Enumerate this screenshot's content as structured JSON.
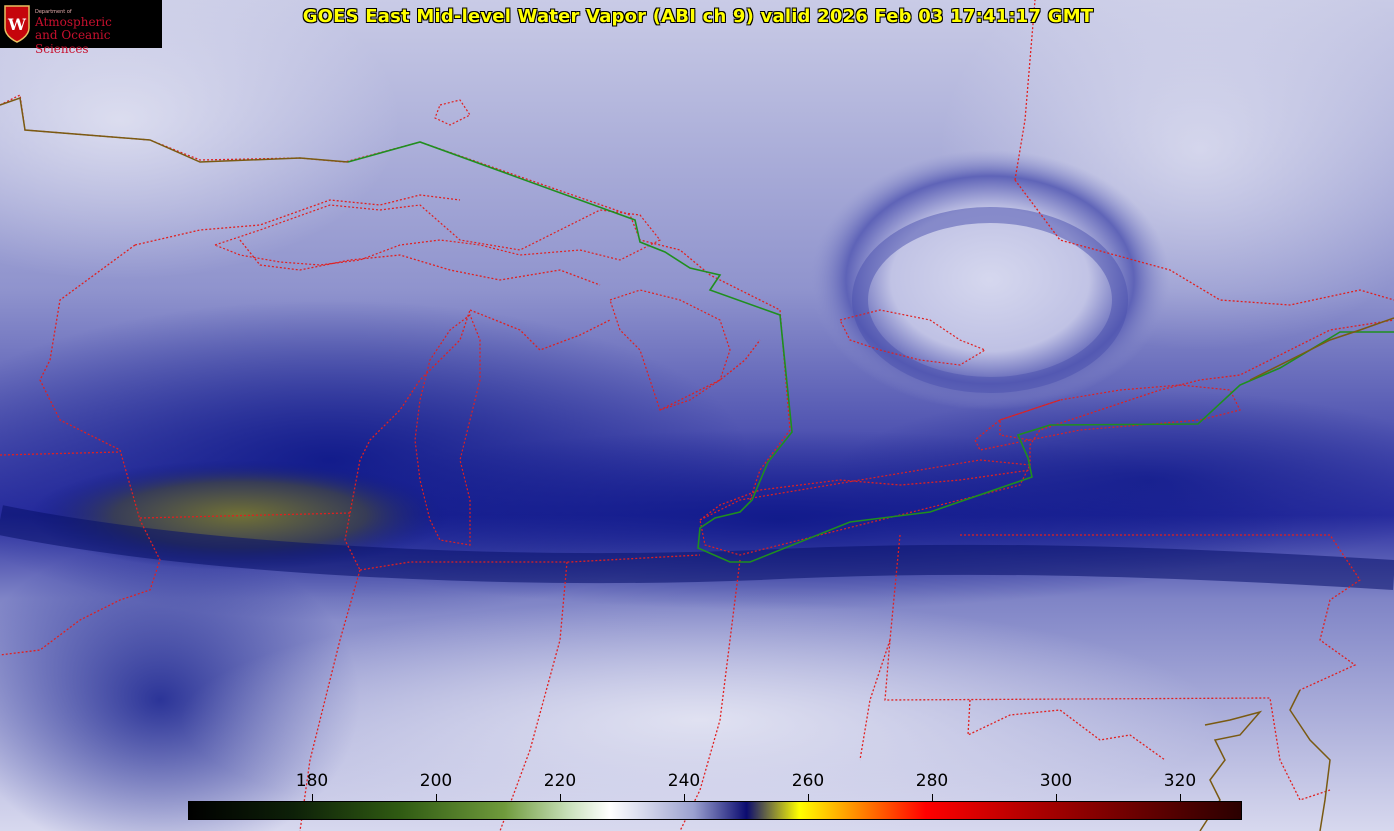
{
  "title": "GOES East Mid-level Water Vapor (ABI ch 9)  valid 2026 Feb 03 17:41:17 GMT",
  "logo": {
    "dept_line": "Department of",
    "name_line1": "Atmospheric",
    "name_line2": "and Oceanic Sciences",
    "seal_letter": "W",
    "icon": "uw-crest-icon"
  },
  "colorbar": {
    "ticks": [
      "180",
      "200",
      "220",
      "240",
      "260",
      "280",
      "300",
      "320"
    ],
    "tick_values": [
      180,
      200,
      220,
      240,
      260,
      280,
      300,
      320
    ],
    "range": [
      160,
      330
    ],
    "colors": [
      "#000000",
      "#0d2008",
      "#2f5a12",
      "#6f9a3c",
      "#c7dfb8",
      "#ffffff",
      "#9aa0cf",
      "#0b0b70",
      "#ffff00",
      "#ff8000",
      "#ff0000",
      "#b00000",
      "#6a0000",
      "#2a0000"
    ]
  },
  "map_colors": {
    "border_state": "#e02020",
    "border_national": "#1f8f1f",
    "coastline": "#7a5a12",
    "vapor_dark": "#0a0f7a",
    "vapor_light": "#e6e6f2"
  }
}
